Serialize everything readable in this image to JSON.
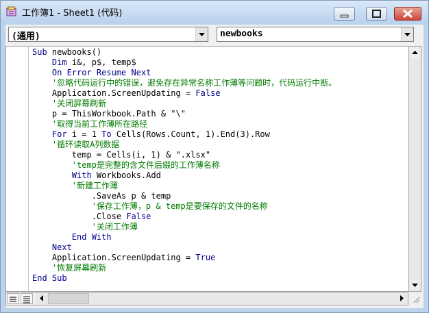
{
  "window": {
    "title": "工作簿1 - Sheet1 (代码)",
    "icon": "vba-module-icon",
    "controls": {
      "minimize": "minimize-icon",
      "maximize": "maximize-icon",
      "close": "close-icon"
    }
  },
  "object_combo": {
    "selected": "(通用)"
  },
  "procedure_combo": {
    "selected": "newbooks"
  },
  "code_lines": [
    {
      "segments": [
        {
          "t": "Sub",
          "c": "kw"
        },
        {
          "t": " newbooks()",
          "c": ""
        }
      ]
    },
    {
      "segments": [
        {
          "t": "    ",
          "c": ""
        },
        {
          "t": "Dim",
          "c": "kw"
        },
        {
          "t": " i&, p$, temp$",
          "c": ""
        }
      ]
    },
    {
      "segments": [
        {
          "t": "    ",
          "c": ""
        },
        {
          "t": "On Error Resume Next",
          "c": "kw"
        }
      ]
    },
    {
      "segments": [
        {
          "t": "    '忽略代码运行中的错误，避免存在异常名称工作薄等问题时，代码运行中断。",
          "c": "cm"
        }
      ]
    },
    {
      "segments": [
        {
          "t": "    Application.ScreenUpdating = ",
          "c": ""
        },
        {
          "t": "False",
          "c": "kw"
        }
      ]
    },
    {
      "segments": [
        {
          "t": "    '关闭屏幕刷新",
          "c": "cm"
        }
      ]
    },
    {
      "segments": [
        {
          "t": "    p = ThisWorkbook.Path & \"\\\"",
          "c": ""
        }
      ]
    },
    {
      "segments": [
        {
          "t": "    '取得当前工作薄所在路径",
          "c": "cm"
        }
      ]
    },
    {
      "segments": [
        {
          "t": "    ",
          "c": ""
        },
        {
          "t": "For",
          "c": "kw"
        },
        {
          "t": " i = 1 ",
          "c": ""
        },
        {
          "t": "To",
          "c": "kw"
        },
        {
          "t": " Cells(Rows.Count, 1).End(3).Row",
          "c": ""
        }
      ]
    },
    {
      "segments": [
        {
          "t": "    '循环读取A列数据",
          "c": "cm"
        }
      ]
    },
    {
      "segments": [
        {
          "t": "        temp = Cells(i, 1) & \".xlsx\"",
          "c": ""
        }
      ]
    },
    {
      "segments": [
        {
          "t": "        'temp是完整的含文件后缀的工作薄名称",
          "c": "cm"
        }
      ]
    },
    {
      "segments": [
        {
          "t": "        ",
          "c": ""
        },
        {
          "t": "With",
          "c": "kw"
        },
        {
          "t": " Workbooks.Add",
          "c": ""
        }
      ]
    },
    {
      "segments": [
        {
          "t": "        '新建工作薄",
          "c": "cm"
        }
      ]
    },
    {
      "segments": [
        {
          "t": "            .SaveAs p & temp",
          "c": ""
        }
      ]
    },
    {
      "segments": [
        {
          "t": "            '保存工作薄，p & temp是要保存的文件的名称",
          "c": "cm"
        }
      ]
    },
    {
      "segments": [
        {
          "t": "            .Close ",
          "c": ""
        },
        {
          "t": "False",
          "c": "kw"
        }
      ]
    },
    {
      "segments": [
        {
          "t": "            '关闭工作薄",
          "c": "cm"
        }
      ]
    },
    {
      "segments": [
        {
          "t": "        ",
          "c": ""
        },
        {
          "t": "End With",
          "c": "kw"
        }
      ]
    },
    {
      "segments": [
        {
          "t": "    ",
          "c": ""
        },
        {
          "t": "Next",
          "c": "kw"
        }
      ]
    },
    {
      "segments": [
        {
          "t": "    Application.ScreenUpdating = ",
          "c": ""
        },
        {
          "t": "True",
          "c": "kw"
        }
      ]
    },
    {
      "segments": [
        {
          "t": "    '恢复屏幕刷新",
          "c": "cm"
        }
      ]
    },
    {
      "segments": [
        {
          "t": "End Sub",
          "c": "kw"
        }
      ]
    }
  ],
  "colors": {
    "keyword": "#00008b",
    "comment": "#007a00",
    "text": "#000000"
  }
}
